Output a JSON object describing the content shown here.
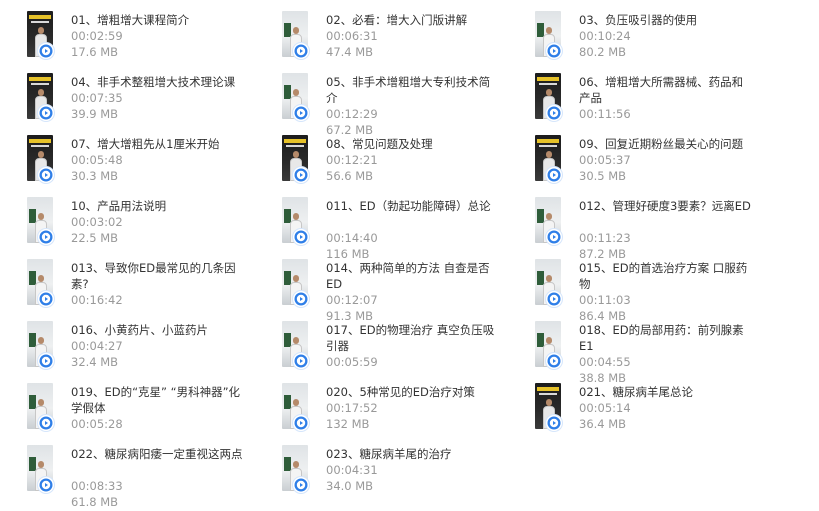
{
  "icons": {
    "play_badge": "play-circle-icon",
    "thumbnail": "video-thumbnail"
  },
  "colors": {
    "title": "#333333",
    "meta": "#999999",
    "badge": "#2f7fe8"
  },
  "items": [
    {
      "title": "01、增粗增大课程简介",
      "duration": "00:02:59",
      "size": "17.6 MB",
      "thumb": "dark"
    },
    {
      "title": "02、必看：增大入门版讲解",
      "duration": "00:06:31",
      "size": "47.4 MB",
      "thumb": "light"
    },
    {
      "title": "03、负压吸引器的使用",
      "duration": "00:10:24",
      "size": "80.2 MB",
      "thumb": "light"
    },
    {
      "title": "04、非手术整粗增大技术理论课",
      "duration": "00:07:35",
      "size": "39.9 MB",
      "thumb": "dark"
    },
    {
      "title": "05、非手术增粗增大专利技术简介",
      "duration": "00:12:29",
      "size": "67.2 MB",
      "thumb": "light"
    },
    {
      "title": "06、增粗增大所需器械、药品和产品",
      "duration": "00:11:56",
      "size": "",
      "thumb": "dark"
    },
    {
      "title": "07、增大增粗先从1厘米开始",
      "duration": "00:05:48",
      "size": "30.3 MB",
      "thumb": "dark"
    },
    {
      "title": "08、常见问题及处理",
      "duration": "00:12:21",
      "size": "56.6 MB",
      "thumb": "dark"
    },
    {
      "title": "09、回复近期粉丝最关心的问题",
      "duration": "00:05:37",
      "size": "30.5 MB",
      "thumb": "dark"
    },
    {
      "title": "10、产品用法说明",
      "duration": "00:03:02",
      "size": "22.5 MB",
      "thumb": "light"
    },
    {
      "title": "011、ED（勃起功能障碍）总论",
      "duration": "00:14:40",
      "size": "116 MB",
      "thumb": "light"
    },
    {
      "title": "012、管理好硬度3要素？远离ED",
      "duration": "00:11:23",
      "size": "87.2 MB",
      "thumb": "light"
    },
    {
      "title": "013、导致你ED最常见的几条因素?",
      "duration": "00:16:42",
      "size": "",
      "thumb": "light"
    },
    {
      "title": "014、两种简单的方法 自查是否ED",
      "duration": "00:12:07",
      "size": "91.3 MB",
      "thumb": "light"
    },
    {
      "title": "015、ED的首选治疗方案 口服药物",
      "duration": "00:11:03",
      "size": "86.4 MB",
      "thumb": "light"
    },
    {
      "title": "016、小黄药片、小蓝药片",
      "duration": "00:04:27",
      "size": "32.4 MB",
      "thumb": "light"
    },
    {
      "title": "017、ED的物理治疗 真空负压吸引器",
      "duration": "00:05:59",
      "size": "",
      "thumb": "light"
    },
    {
      "title": "018、ED的局部用药：前列腺素E1",
      "duration": "00:04:55",
      "size": "38.8 MB",
      "thumb": "light"
    },
    {
      "title": "019、ED的“克星” “男科神器”化学假体",
      "duration": "00:05:28",
      "size": "",
      "thumb": "light"
    },
    {
      "title": "020、5种常见的ED治疗对策",
      "duration": "00:17:52",
      "size": "132 MB",
      "thumb": "light"
    },
    {
      "title": "021、糖尿病羊尾总论",
      "duration": "00:05:14",
      "size": "36.4 MB",
      "thumb": "dark"
    },
    {
      "title": "022、糖尿病阳痿一定重视这两点",
      "duration": "00:08:33",
      "size": "61.8 MB",
      "thumb": "light"
    },
    {
      "title": "023、糖尿病羊尾的治疗",
      "duration": "00:04:31",
      "size": "34.0 MB",
      "thumb": "light"
    }
  ]
}
